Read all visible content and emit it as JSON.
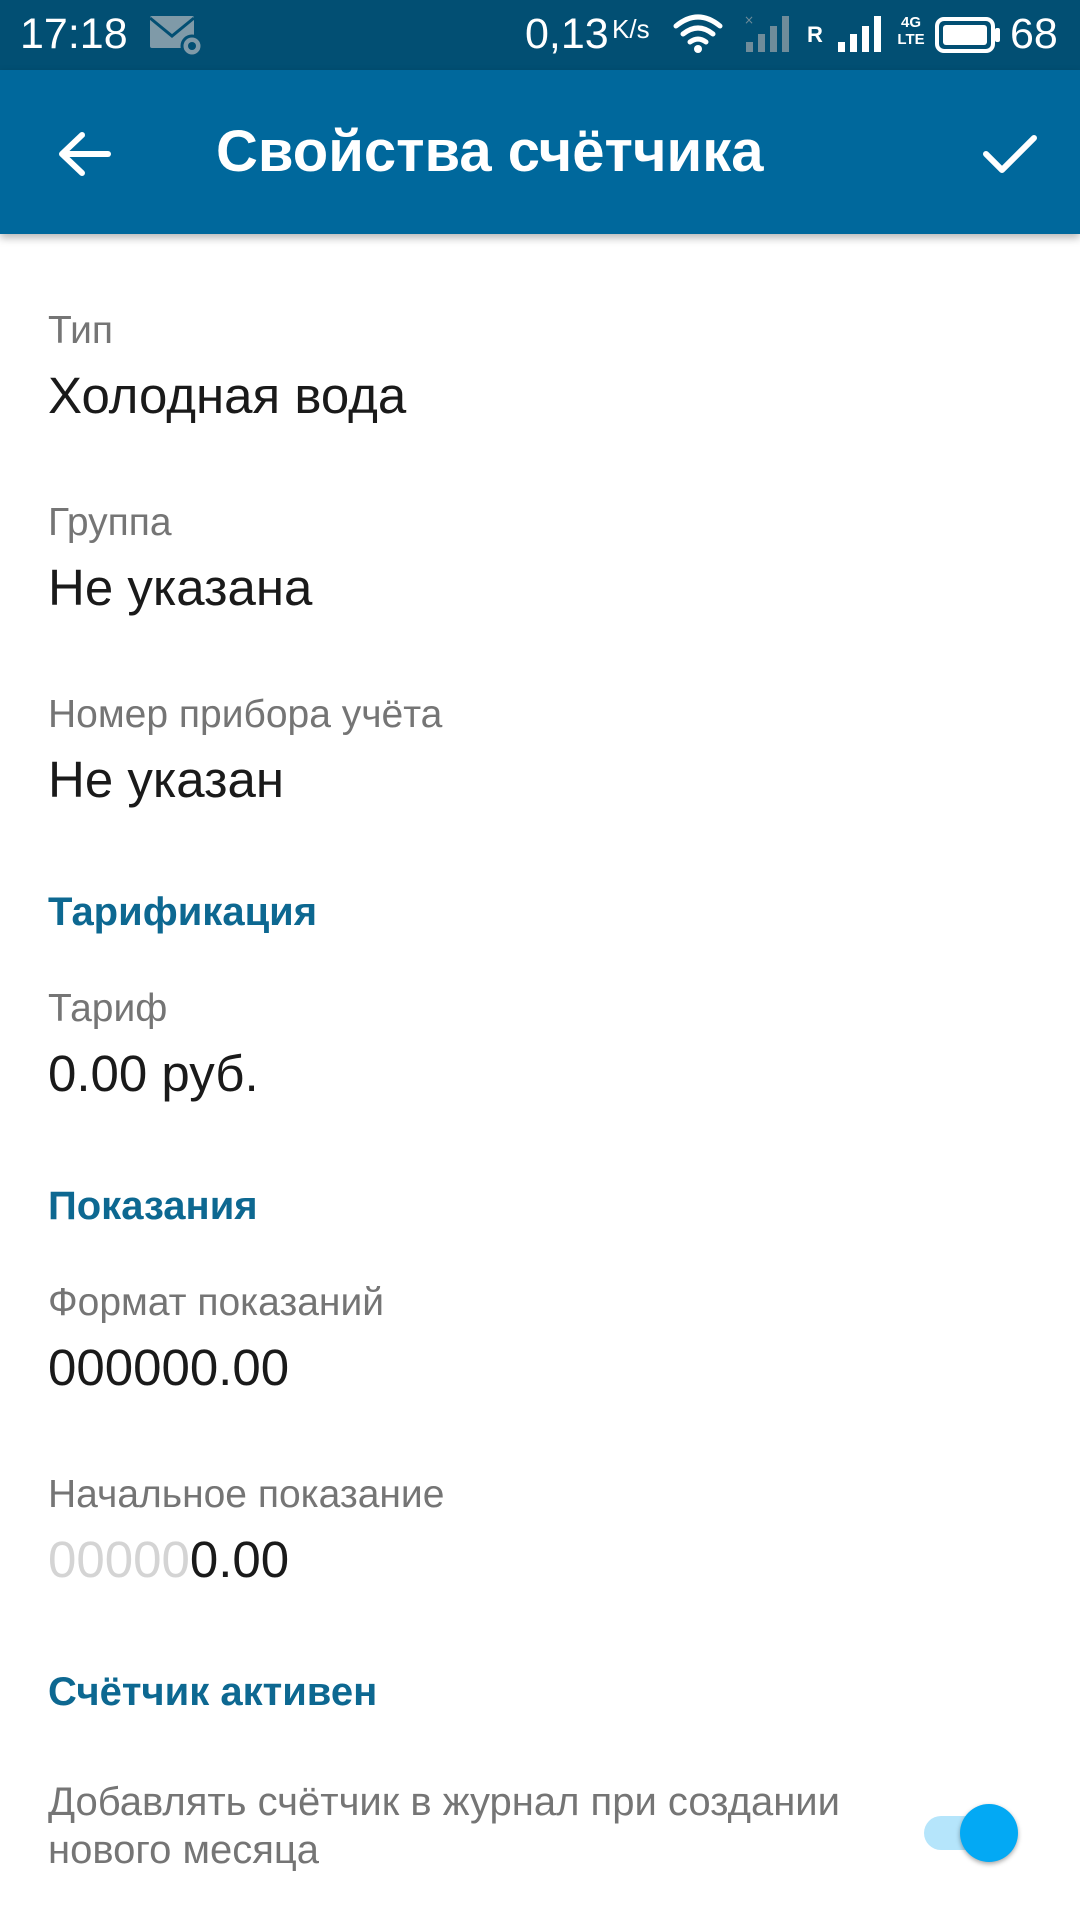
{
  "status_bar": {
    "time": "17:18",
    "net_speed": "0,13",
    "net_speed_unit": "K/s",
    "roaming_label": "R",
    "network_type_top": "4G",
    "network_type_bottom": "LTE",
    "battery_percent": "68",
    "icons": [
      "mail-settings-icon",
      "wifi-icon",
      "signal-icon",
      "battery-icon"
    ]
  },
  "app_bar": {
    "title": "Свойства счётчика",
    "back_icon": "arrow-back-icon",
    "confirm_icon": "check-icon",
    "color": "#00689c"
  },
  "fields": {
    "type": {
      "label": "Тип",
      "value": "Холодная вода"
    },
    "group": {
      "label": "Группа",
      "value": "Не указана"
    },
    "meter_number": {
      "label": "Номер прибора учёта",
      "value": "Не указан"
    }
  },
  "sections": {
    "tariffing": "Тарификация",
    "readings": "Показания",
    "active": "Счётчик активен"
  },
  "tariff": {
    "label": "Тариф",
    "value": "0.00 руб."
  },
  "readings": {
    "format": {
      "label": "Формат показаний",
      "value": "000000.00"
    },
    "initial": {
      "label": "Начальное показание",
      "value_leading": "00000",
      "value_main": "0.00"
    }
  },
  "toggle": {
    "label": "Добавлять счётчик в журнал при создании нового месяца",
    "enabled": true,
    "accent_color": "#03a9f4"
  },
  "colors": {
    "status_bar": "#024f73",
    "section_header": "#0d6891",
    "label": "#757575",
    "value": "#1a1a1a"
  }
}
